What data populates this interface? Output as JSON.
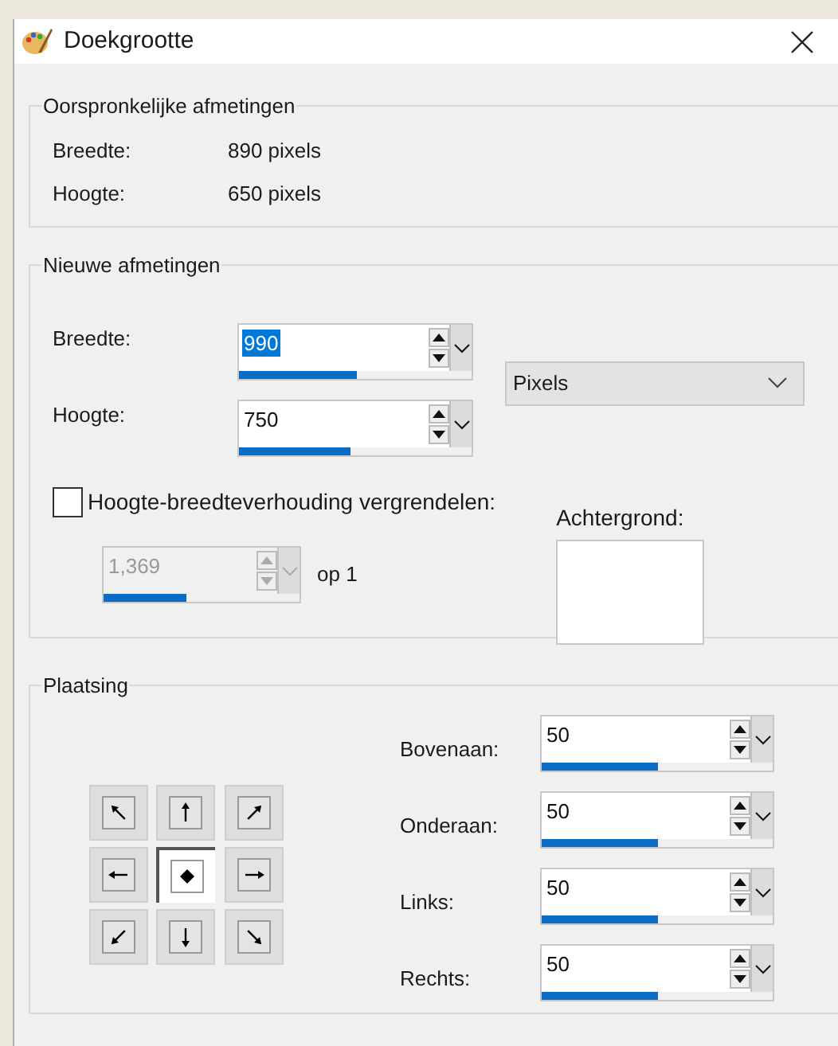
{
  "window": {
    "title": "Doekgrootte"
  },
  "original_size": {
    "title": "Oorspronkelijke afmetingen",
    "rows": [
      {
        "label": "Breedte:",
        "value": "890 pixels"
      },
      {
        "label": "Hoogte:",
        "value": "650 pixels"
      }
    ]
  },
  "new_size": {
    "title": "Nieuwe afmetingen",
    "fields": [
      {
        "label": "Breedte:",
        "value": "990",
        "text_selected": true,
        "level": 0.51
      },
      {
        "label": "Hoogte:",
        "value": "750",
        "text_selected": false,
        "level": 0.48
      }
    ],
    "unit": {
      "value": "Pixels"
    },
    "lock_ratio": {
      "label": "Hoogte-breedteverhouding vergrendelen:",
      "checked": false
    },
    "ratio": {
      "value": "1,369",
      "disabled": true,
      "level": 0.42,
      "suffix": "op 1"
    },
    "background": {
      "label": "Achtergrond:",
      "color": "#ffffff"
    }
  },
  "placement": {
    "title": "Plaatsing",
    "anchors": [
      {
        "selected": false
      },
      {
        "selected": false
      },
      {
        "selected": false
      },
      {
        "selected": false
      },
      {
        "selected": true
      },
      {
        "selected": false
      },
      {
        "selected": false
      },
      {
        "selected": false
      },
      {
        "selected": false
      }
    ],
    "fields": [
      {
        "label": "Bovenaan:",
        "value": "50",
        "level": 0.5
      },
      {
        "label": "Onderaan:",
        "value": "50",
        "level": 0.5
      },
      {
        "label": "Links:",
        "value": "50",
        "level": 0.5
      },
      {
        "label": "Rechts:",
        "value": "50",
        "level": 0.5
      }
    ]
  }
}
